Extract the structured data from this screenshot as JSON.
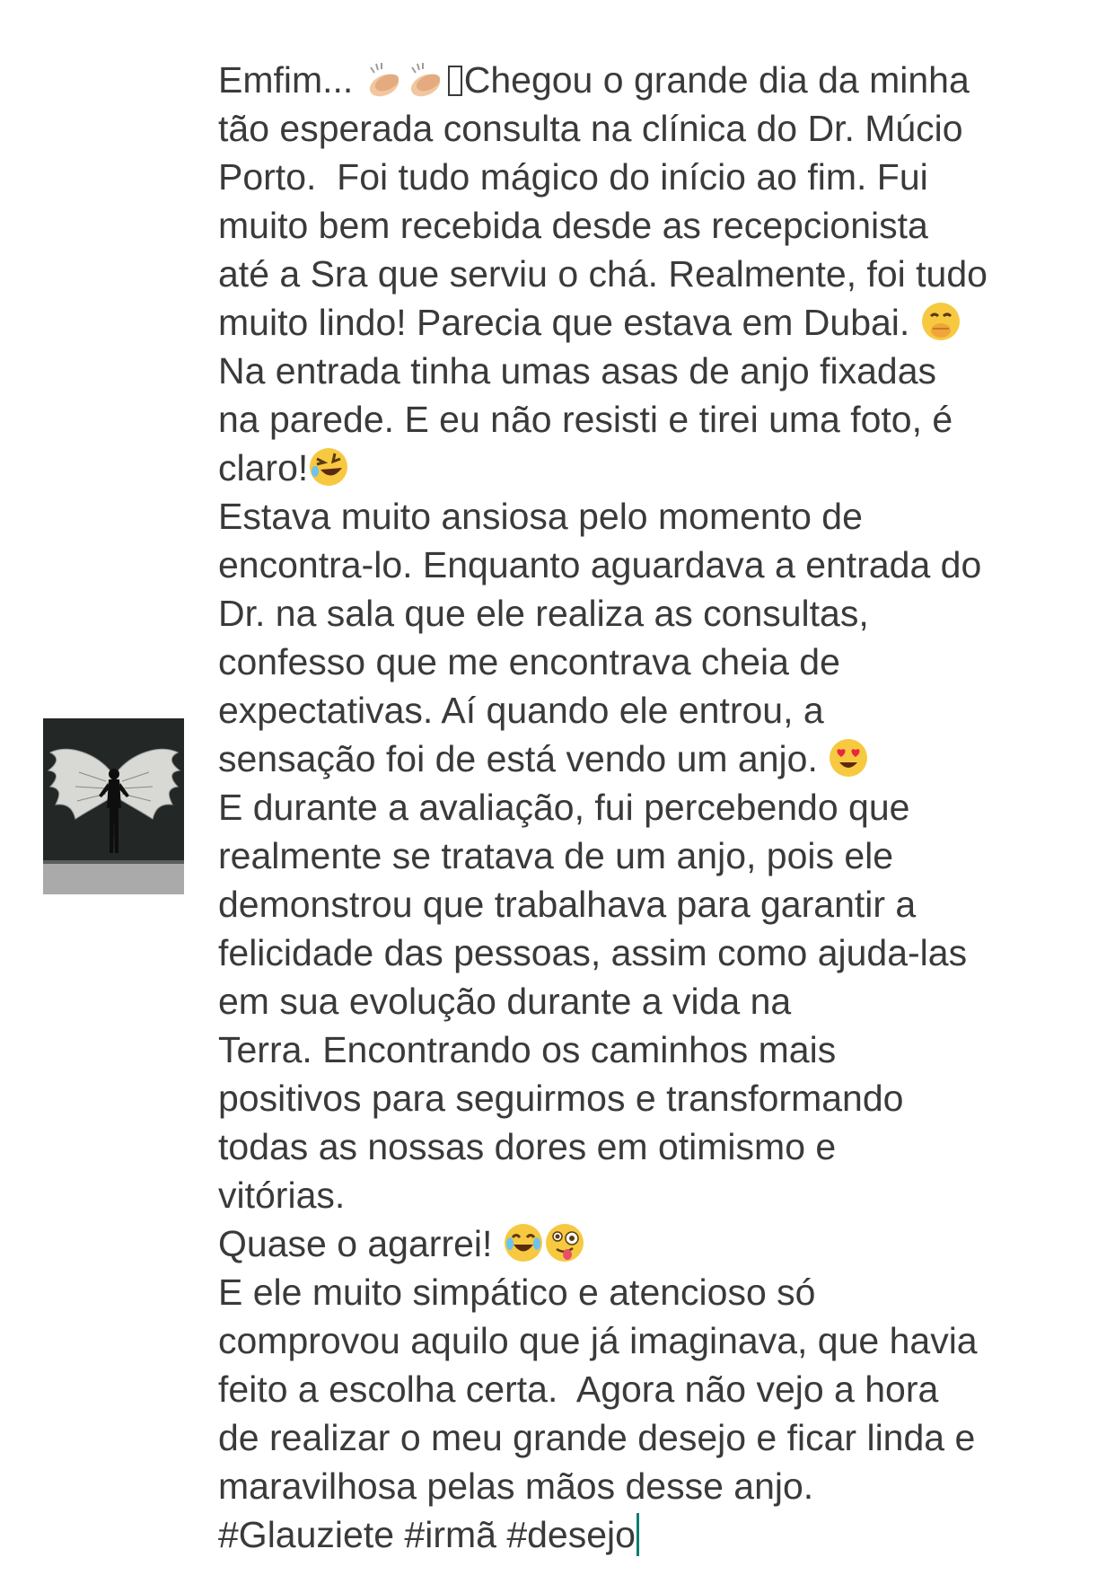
{
  "post": {
    "lines": [
      "Emfim...",
      "Chegou o grande dia da minha",
      "tão esperada consulta na clínica do Dr. Múcio",
      "Porto.  Foi tudo mágico do início ao fim. Fui",
      "muito bem recebida desde as recepcionista",
      "até a Sra que serviu o chá. Realmente, foi tudo",
      "muito lindo! Parecia que estava em Dubai.",
      "Na entrada tinha umas asas de anjo fixadas",
      "na parede. E eu não resisti e tirei uma foto, é",
      "claro!",
      "Estava muito ansiosa pelo momento de",
      "encontra-lo. Enquanto aguardava a entrada do",
      "Dr. na sala que ele realiza as consultas,",
      "confesso que me encontrava cheia de",
      "expectativas. Aí quando ele entrou, a",
      "sensação foi de está vendo um anjo.",
      "E durante a avaliação, fui percebendo que",
      "realmente se tratava de um anjo, pois ele",
      "demonstrou que trabalhava para garantir a",
      "felicidade das pessoas, assim como ajuda-las",
      "em sua evolução durante a vida na",
      "Terra. Encontrando os caminhos mais",
      "positivos para seguirmos e transformando",
      "todas as nossas dores em otimismo e",
      "vitórias.",
      "Quase o agarrei!",
      "E ele muito simpático e atencioso só",
      "comprovou aquilo que já imaginava, que havia",
      "feito a escolha certa.  Agora não vejo a hora",
      "de realizar o meu grande desejo e ficar linda e",
      "maravilhosa pelas mãos desse anjo.",
      "#Glauziete #irmã #desejo"
    ]
  },
  "emojis": {
    "clap": "clapping-hands-icon",
    "shush": "face-with-hand-over-mouth-icon",
    "rofl": "rolling-on-floor-laughing-icon",
    "hearteyes": "heart-eyes-icon",
    "tearsjoy": "tears-of-joy-icon",
    "zany": "zany-face-icon"
  },
  "colors": {
    "text": "#3a3a3a",
    "caret": "#0f7d73",
    "emoji_yellow": "#f7c940"
  },
  "thumbnail": {
    "icon": "angel-wings-photo"
  }
}
